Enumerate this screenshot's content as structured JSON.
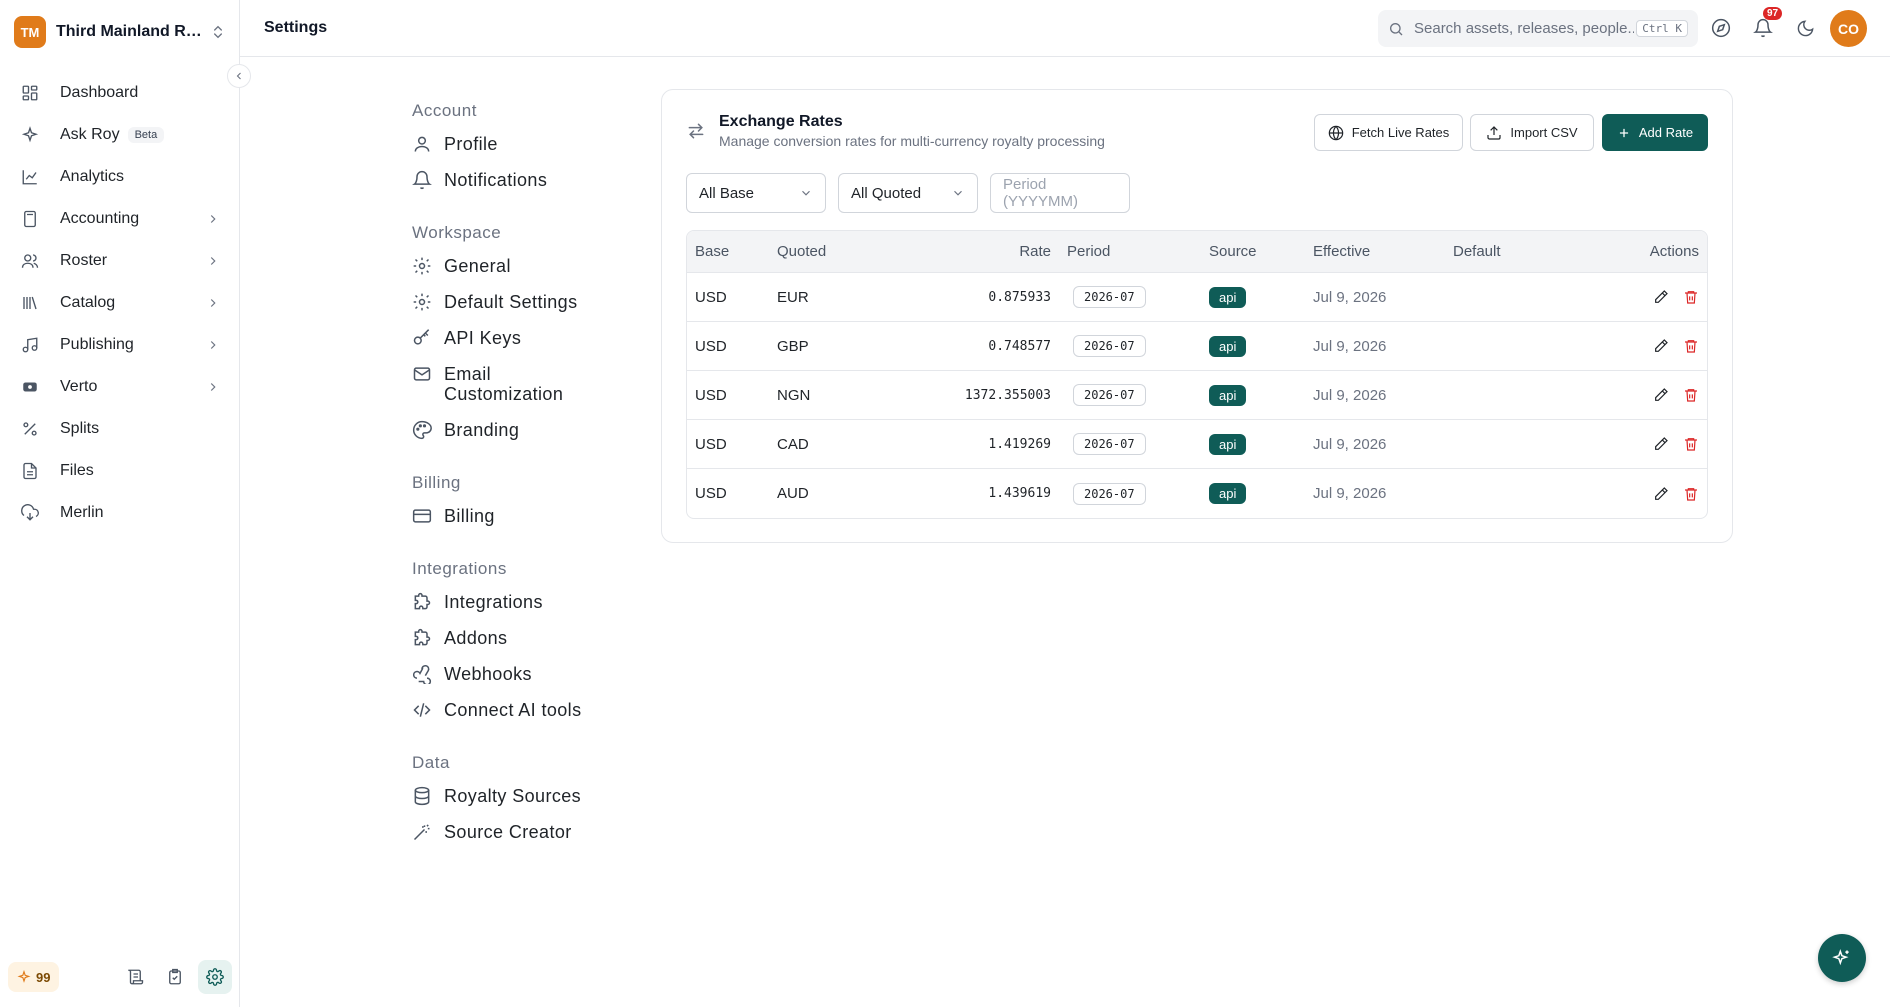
{
  "org": {
    "initials": "TM",
    "name": "Third Mainland Rec..."
  },
  "sidebar": {
    "items": [
      {
        "label": "Dashboard",
        "icon": "dashboard-icon"
      },
      {
        "label": "Ask Roy",
        "badge": "Beta",
        "icon": "sparkle-icon"
      },
      {
        "label": "Analytics",
        "icon": "chart-line-icon"
      },
      {
        "label": "Accounting",
        "icon": "calculator-icon",
        "expandable": true
      },
      {
        "label": "Roster",
        "icon": "users-icon",
        "expandable": true
      },
      {
        "label": "Catalog",
        "icon": "library-icon",
        "expandable": true
      },
      {
        "label": "Publishing",
        "icon": "music-icon",
        "expandable": true
      },
      {
        "label": "Verto",
        "icon": "verto-icon",
        "expandable": true
      },
      {
        "label": "Splits",
        "icon": "percent-icon"
      },
      {
        "label": "Files",
        "icon": "file-icon"
      },
      {
        "label": "Merlin",
        "icon": "cloud-download-icon"
      }
    ],
    "credits": "99"
  },
  "header": {
    "title": "Settings",
    "search_placeholder": "Search assets, releases, people...",
    "shortcut": "Ctrl K",
    "notification_count": "97",
    "user_initials": "CO"
  },
  "settings_nav": {
    "sections": [
      {
        "title": "Account",
        "items": [
          "Profile",
          "Notifications"
        ]
      },
      {
        "title": "Workspace",
        "items": [
          "General",
          "Default Settings",
          "API Keys",
          "Email Customization",
          "Branding"
        ]
      },
      {
        "title": "Billing",
        "items": [
          "Billing"
        ]
      },
      {
        "title": "Integrations",
        "items": [
          "Integrations",
          "Addons",
          "Webhooks",
          "Connect AI tools"
        ]
      },
      {
        "title": "Data",
        "items": [
          "Royalty Sources",
          "Source Creator"
        ]
      }
    ]
  },
  "card": {
    "title": "Exchange Rates",
    "subtitle": "Manage conversion rates for multi-currency royalty processing",
    "buttons": {
      "fetch": "Fetch Live Rates",
      "import": "Import CSV",
      "add": "Add Rate"
    },
    "filters": {
      "base": "All Base",
      "quoted": "All Quoted",
      "period_placeholder": "Period (YYYYMM)"
    }
  },
  "table": {
    "headers": [
      "Base",
      "Quoted",
      "Rate",
      "Period",
      "Source",
      "Effective",
      "Default",
      "Actions"
    ],
    "rows": [
      {
        "base": "USD",
        "quoted": "EUR",
        "rate": "0.875933",
        "period": "2026-07",
        "source": "api",
        "effective": "Jul 9, 2026",
        "default": ""
      },
      {
        "base": "USD",
        "quoted": "GBP",
        "rate": "0.748577",
        "period": "2026-07",
        "source": "api",
        "effective": "Jul 9, 2026",
        "default": ""
      },
      {
        "base": "USD",
        "quoted": "NGN",
        "rate": "1372.355003",
        "period": "2026-07",
        "source": "api",
        "effective": "Jul 9, 2026",
        "default": ""
      },
      {
        "base": "USD",
        "quoted": "CAD",
        "rate": "1.419269",
        "period": "2026-07",
        "source": "api",
        "effective": "Jul 9, 2026",
        "default": ""
      },
      {
        "base": "USD",
        "quoted": "AUD",
        "rate": "1.439619",
        "period": "2026-07",
        "source": "api",
        "effective": "Jul 9, 2026",
        "default": ""
      }
    ]
  },
  "colors": {
    "brand": "#0f5c57",
    "accent_orange": "#e07b1a",
    "danger": "#dc2626"
  }
}
